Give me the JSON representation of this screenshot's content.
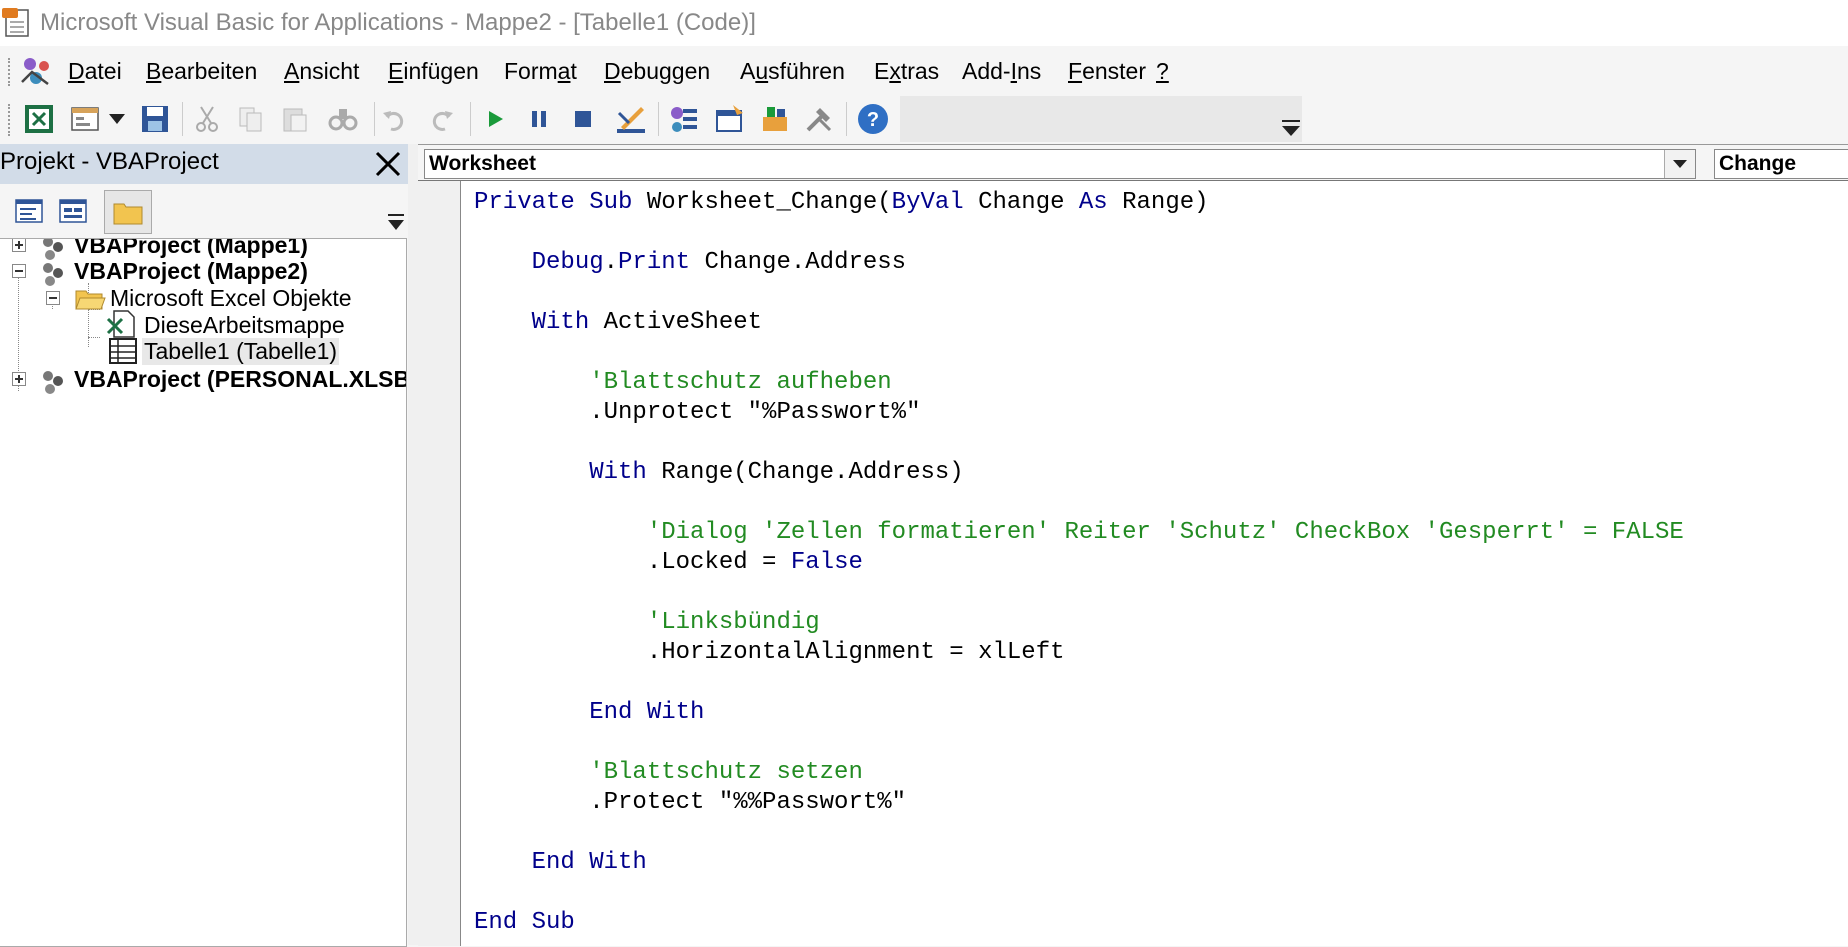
{
  "window": {
    "title": "Microsoft Visual Basic for Applications - Mappe2 - [Tabelle1 (Code)]"
  },
  "menu": [
    {
      "pre": "",
      "acc": "D",
      "post": "atei"
    },
    {
      "pre": "",
      "acc": "B",
      "post": "earbeiten"
    },
    {
      "pre": "",
      "acc": "A",
      "post": "nsicht"
    },
    {
      "pre": "",
      "acc": "E",
      "post": "infügen"
    },
    {
      "pre": "Form",
      "acc": "a",
      "post": "t"
    },
    {
      "pre": "",
      "acc": "D",
      "post": "ebuggen"
    },
    {
      "pre": "A",
      "acc": "u",
      "post": "sführen"
    },
    {
      "pre": "E",
      "acc": "x",
      "post": "tras"
    },
    {
      "pre": "Add-",
      "acc": "I",
      "post": "ns"
    },
    {
      "pre": "",
      "acc": "F",
      "post": "enster"
    },
    {
      "pre": "",
      "acc": "?",
      "post": ""
    }
  ],
  "project": {
    "title": "Projekt - VBAProject",
    "tree": [
      {
        "label": "VBAProject (Mappe1)",
        "bold": true
      },
      {
        "label": "VBAProject (Mappe2)",
        "bold": true
      },
      {
        "label": "Microsoft Excel Objekte",
        "bold": false
      },
      {
        "label": "DieseArbeitsmappe",
        "bold": false
      },
      {
        "label": "Tabelle1 (Tabelle1)",
        "bold": false
      },
      {
        "label": "VBAProject (PERSONAL.XLSB)",
        "bold": true
      }
    ]
  },
  "code_window": {
    "object_combo": "Worksheet",
    "procedure_combo": "Change",
    "lines": [
      [
        [
          "kw",
          "Private Sub "
        ],
        [
          "",
          "Worksheet_Change("
        ],
        [
          "kw",
          "ByVal"
        ],
        [
          "",
          " Change "
        ],
        [
          "kw",
          "As"
        ],
        [
          "",
          " Range)"
        ]
      ],
      [],
      [
        [
          "",
          "    "
        ],
        [
          "kw",
          "Debug"
        ],
        [
          "",
          "."
        ],
        [
          "kw",
          "Print"
        ],
        [
          "",
          " Change.Address"
        ]
      ],
      [],
      [
        [
          "",
          "    "
        ],
        [
          "kw",
          "With"
        ],
        [
          "",
          " ActiveSheet"
        ]
      ],
      [],
      [
        [
          "",
          "        "
        ],
        [
          "cm",
          "'Blattschutz aufheben"
        ]
      ],
      [
        [
          "",
          "        .Unprotect \"%Passwort%\""
        ]
      ],
      [],
      [
        [
          "",
          "        "
        ],
        [
          "kw",
          "With"
        ],
        [
          "",
          " Range(Change.Address)"
        ]
      ],
      [],
      [
        [
          "",
          "            "
        ],
        [
          "cm",
          "'Dialog 'Zellen formatieren' Reiter 'Schutz' CheckBox 'Gesperrt' = FALSE"
        ]
      ],
      [
        [
          "",
          "            .Locked = "
        ],
        [
          "kw",
          "False"
        ]
      ],
      [],
      [
        [
          "",
          "            "
        ],
        [
          "cm",
          "'Linksbündig"
        ]
      ],
      [
        [
          "",
          "            .HorizontalAlignment = xlLeft"
        ]
      ],
      [],
      [
        [
          "",
          "        "
        ],
        [
          "kw",
          "End With"
        ]
      ],
      [],
      [
        [
          "",
          "        "
        ],
        [
          "cm",
          "'Blattschutz setzen"
        ]
      ],
      [
        [
          "",
          "        .Protect \"%%Passwort%\""
        ]
      ],
      [],
      [
        [
          "",
          "    "
        ],
        [
          "kw",
          "End With"
        ]
      ],
      [],
      [
        [
          "kw",
          "End Sub"
        ]
      ]
    ]
  }
}
